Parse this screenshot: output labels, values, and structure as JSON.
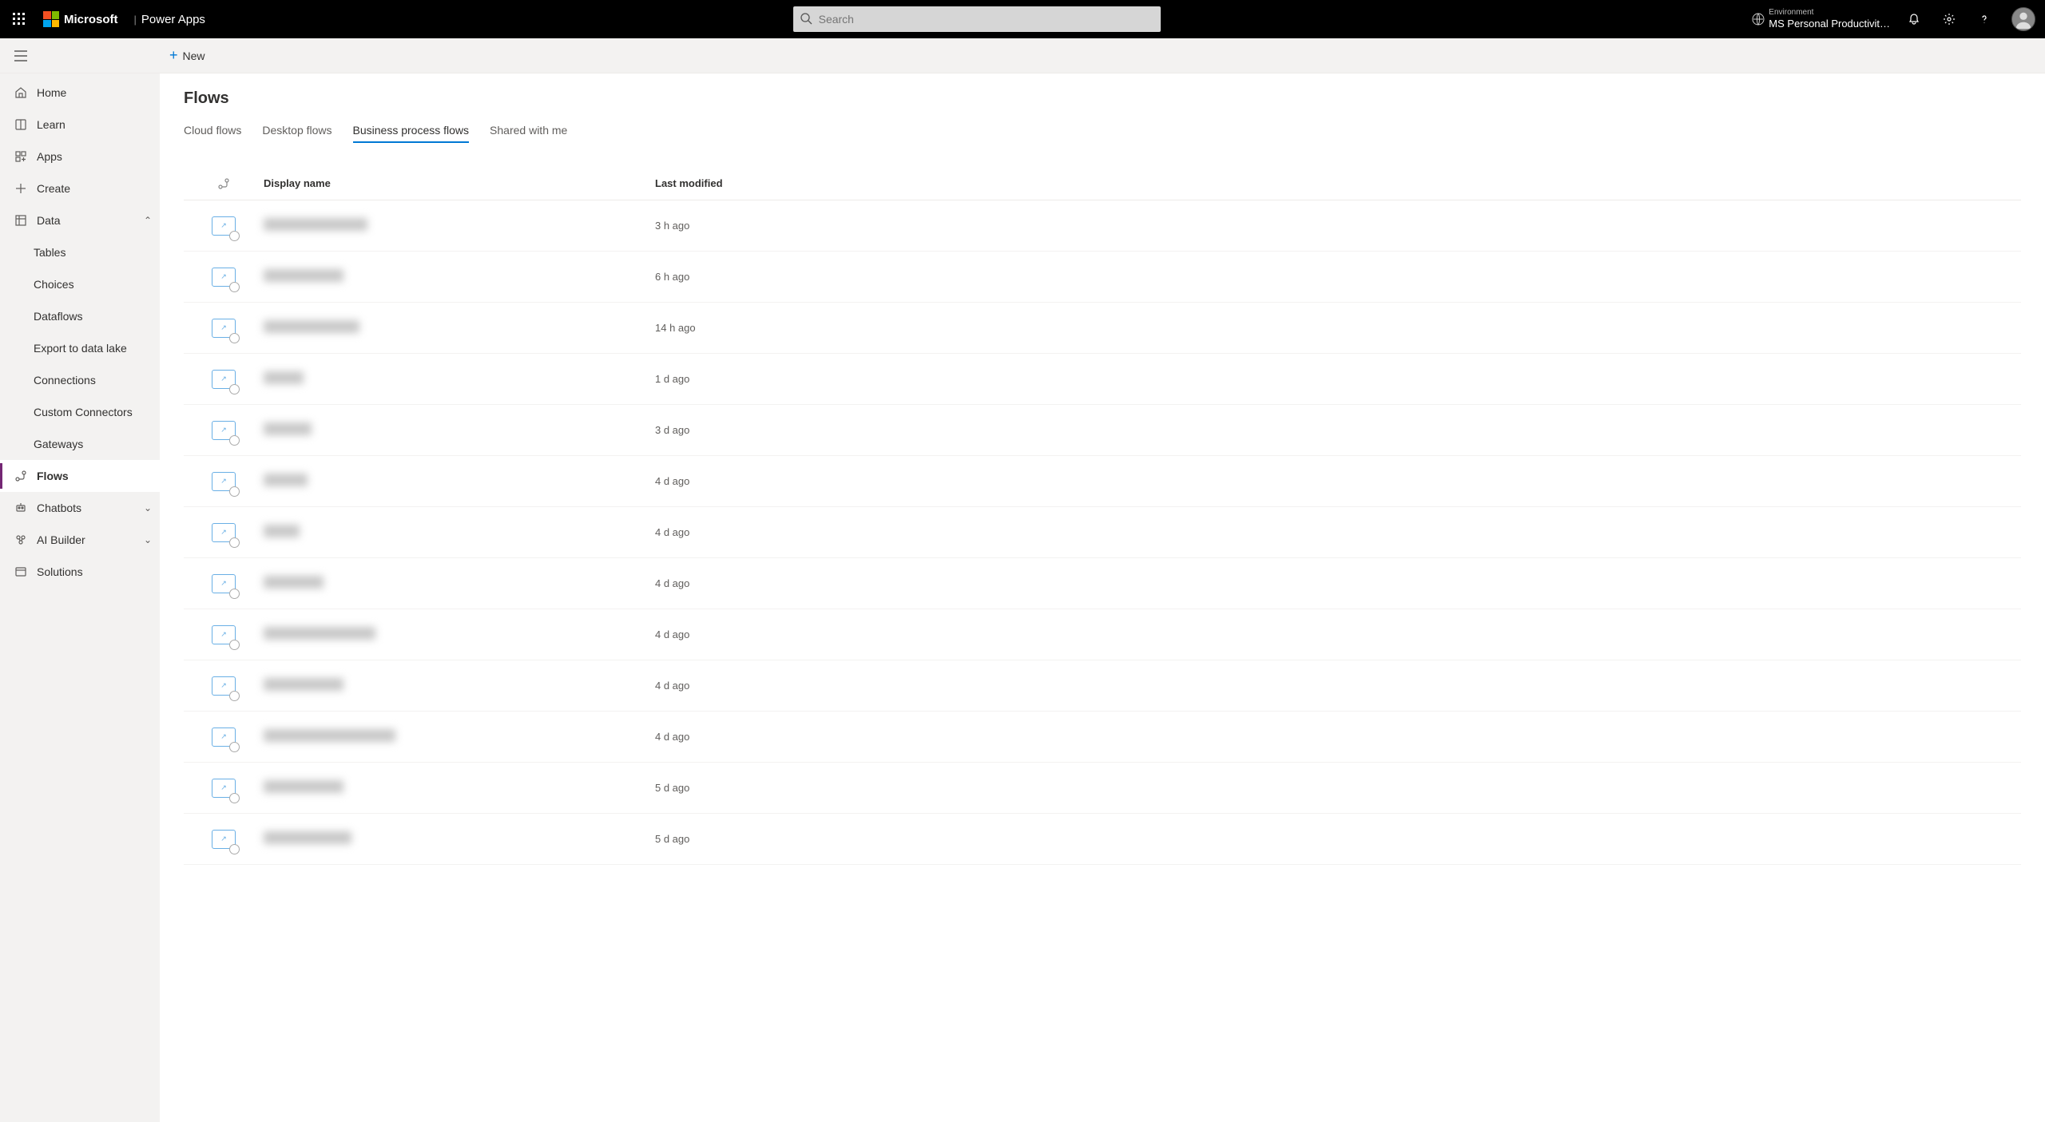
{
  "topbar": {
    "vendor": "Microsoft",
    "product": "Power Apps",
    "search_placeholder": "Search",
    "env_label": "Environment",
    "env_name": "MS Personal Productivit…"
  },
  "commandbar": {
    "new_label": "New"
  },
  "sidebar": {
    "items": [
      {
        "label": "Home",
        "icon": "home"
      },
      {
        "label": "Learn",
        "icon": "book"
      },
      {
        "label": "Apps",
        "icon": "apps"
      },
      {
        "label": "Create",
        "icon": "plus"
      },
      {
        "label": "Data",
        "icon": "data",
        "expanded": true
      },
      {
        "label": "Flows",
        "icon": "flow",
        "active": true
      },
      {
        "label": "Chatbots",
        "icon": "bot",
        "collapsible": true
      },
      {
        "label": "AI Builder",
        "icon": "ai",
        "collapsible": true
      },
      {
        "label": "Solutions",
        "icon": "solutions"
      }
    ],
    "data_children": [
      {
        "label": "Tables"
      },
      {
        "label": "Choices"
      },
      {
        "label": "Dataflows"
      },
      {
        "label": "Export to data lake"
      },
      {
        "label": "Connections"
      },
      {
        "label": "Custom Connectors"
      },
      {
        "label": "Gateways"
      }
    ]
  },
  "page": {
    "title": "Flows",
    "tabs": [
      {
        "label": "Cloud flows"
      },
      {
        "label": "Desktop flows"
      },
      {
        "label": "Business process flows",
        "active": true
      },
      {
        "label": "Shared with me"
      }
    ]
  },
  "table": {
    "columns": {
      "name": "Display name",
      "modified": "Last modified"
    },
    "rows": [
      {
        "name_redacted": true,
        "name_width": 130,
        "modified": "3 h ago"
      },
      {
        "name_redacted": true,
        "name_width": 100,
        "modified": "6 h ago"
      },
      {
        "name_redacted": true,
        "name_width": 120,
        "modified": "14 h ago"
      },
      {
        "name_redacted": true,
        "name_width": 50,
        "modified": "1 d ago"
      },
      {
        "name_redacted": true,
        "name_width": 60,
        "modified": "3 d ago"
      },
      {
        "name_redacted": true,
        "name_width": 55,
        "modified": "4 d ago"
      },
      {
        "name_redacted": true,
        "name_width": 45,
        "modified": "4 d ago"
      },
      {
        "name_redacted": true,
        "name_width": 75,
        "modified": "4 d ago"
      },
      {
        "name_redacted": true,
        "name_width": 140,
        "modified": "4 d ago"
      },
      {
        "name_redacted": true,
        "name_width": 100,
        "modified": "4 d ago"
      },
      {
        "name_redacted": true,
        "name_width": 165,
        "modified": "4 d ago"
      },
      {
        "name_redacted": true,
        "name_width": 100,
        "modified": "5 d ago"
      },
      {
        "name_redacted": true,
        "name_width": 110,
        "modified": "5 d ago"
      }
    ]
  }
}
